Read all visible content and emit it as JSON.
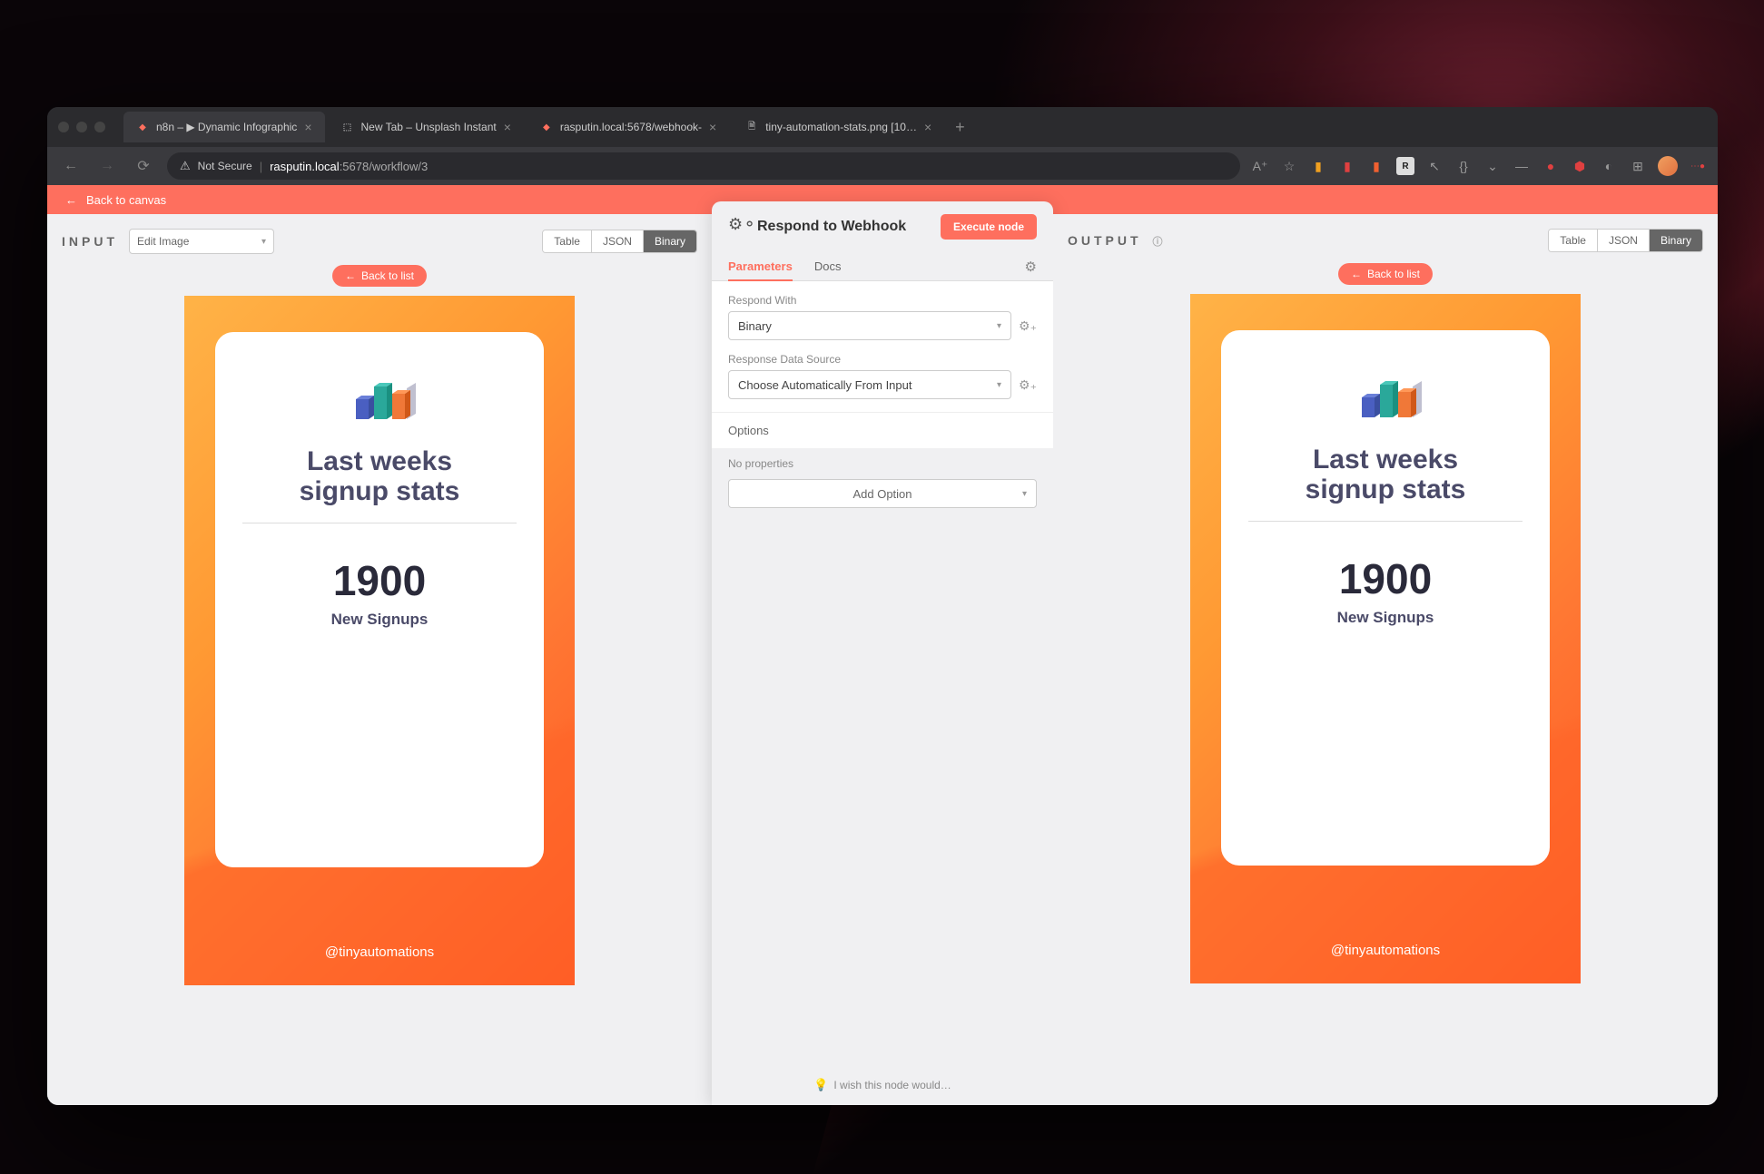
{
  "browser": {
    "tabs": [
      {
        "favicon": "n8n",
        "label": "n8n – ▶ Dynamic Infographic",
        "active": true
      },
      {
        "favicon": "unsplash",
        "label": "New Tab – Unsplash Instant",
        "active": false
      },
      {
        "favicon": "n8n",
        "label": "rasputin.local:5678/webhook-",
        "active": false
      },
      {
        "favicon": "file",
        "label": "tiny-automation-stats.png [10…",
        "active": false
      }
    ],
    "url": {
      "warn": "Not Secure",
      "host": "rasputin.local",
      "port": ":5678",
      "path": "/workflow/3"
    }
  },
  "app": {
    "back_to_canvas": "Back to canvas",
    "input": {
      "title": "INPUT",
      "select": "Edit Image",
      "tabs": [
        "Table",
        "JSON",
        "Binary"
      ],
      "active_tab": "Binary",
      "back_to_list": "Back to list"
    },
    "output": {
      "title": "OUTPUT",
      "tabs": [
        "Table",
        "JSON",
        "Binary"
      ],
      "active_tab": "Binary",
      "back_to_list": "Back to list"
    },
    "infographic": {
      "title_line1": "Last weeks",
      "title_line2": "signup stats",
      "big_number": "1900",
      "sub_label": "New Signups",
      "handle": "@tinyautomations"
    },
    "bottom_hint": "I wish this node would…"
  },
  "node": {
    "title": "Respond to Webhook",
    "execute": "Execute node",
    "tabs": {
      "parameters": "Parameters",
      "docs": "Docs"
    },
    "fields": {
      "respond_with": {
        "label": "Respond With",
        "value": "Binary"
      },
      "data_source": {
        "label": "Response Data Source",
        "value": "Choose Automatically From Input"
      }
    },
    "options_label": "Options",
    "no_properties": "No properties",
    "add_option": "Add Option"
  }
}
